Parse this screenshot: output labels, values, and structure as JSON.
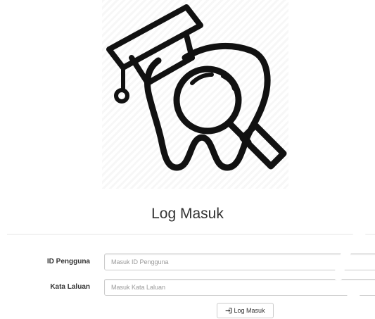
{
  "page": {
    "title": "Log Masuk"
  },
  "logo": {
    "icon": "tooth-graduation-magnifier-icon"
  },
  "form": {
    "username": {
      "label": "ID Pengguna",
      "placeholder": "Masuk ID Pengguna",
      "value": ""
    },
    "password": {
      "label": "Kata Laluan",
      "placeholder": "Masuk Kata Laluan",
      "value": ""
    },
    "submit": {
      "label": "Log Masuk",
      "icon": "sign-in-icon"
    }
  },
  "colors": {
    "text": "#333333",
    "border": "#cccccc",
    "placeholder": "#999999",
    "divider": "#e5e5e5"
  }
}
